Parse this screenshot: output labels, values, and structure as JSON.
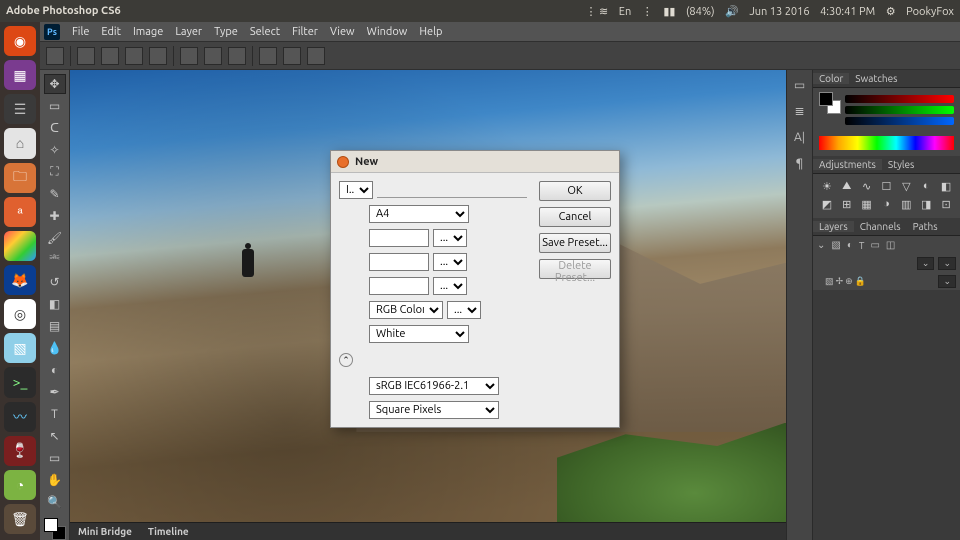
{
  "system": {
    "window_title": "Adobe Photoshop CS6",
    "battery": "(84%)",
    "date": "Jun 13 2016",
    "time": "4:30:41 PM",
    "user": "PookyFox",
    "lang": "En"
  },
  "ps_menu": [
    "File",
    "Edit",
    "Image",
    "Layer",
    "Type",
    "Select",
    "Filter",
    "View",
    "Window",
    "Help"
  ],
  "bottom_tabs": {
    "mini_bridge": "Mini Bridge",
    "timeline": "Timeline"
  },
  "panels": {
    "color_tab": "Color",
    "swatches_tab": "Swatches",
    "adjustments_tab": "Adjustments",
    "styles_tab": "Styles",
    "layers_tab": "Layers",
    "channels_tab": "Channels",
    "paths_tab": "Paths"
  },
  "dialog": {
    "title": "New",
    "name_label": "I...",
    "preset": "A4",
    "unit1": "...",
    "unit2": "...",
    "unit3": "...",
    "color_mode": "RGB Color",
    "color_depth": "...",
    "background": "White",
    "profile": "sRGB IEC61966-2.1",
    "pixel_aspect": "Square Pixels",
    "buttons": {
      "ok": "OK",
      "cancel": "Cancel",
      "save_preset": "Save Preset...",
      "delete_preset": "Delete Preset..."
    }
  }
}
